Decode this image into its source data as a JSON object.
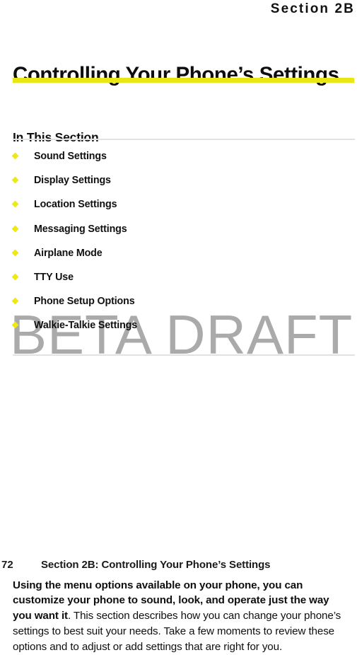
{
  "document": {
    "running_head": "Section 2B",
    "chapter_title": "Controlling Your Phone’s Settings",
    "accent_color": "#e8e613",
    "bullet_color": "#ece81a",
    "rule_color": "#e2e2e2"
  },
  "in_this_section": {
    "heading": "In This Section",
    "items": [
      {
        "label": "Sound Settings"
      },
      {
        "label": "Display Settings"
      },
      {
        "label": "Location Settings"
      },
      {
        "label": "Messaging Settings"
      },
      {
        "label": "Airplane Mode"
      },
      {
        "label": "TTY Use"
      },
      {
        "label": "Phone Setup Options"
      },
      {
        "label": "Walkie-Talkie Settings"
      }
    ]
  },
  "watermark": {
    "text": "BETA DRAFT",
    "color": "#aaaaaa"
  },
  "body": {
    "lead": "Using the menu options available on your phone, you can customize your phone to sound, look, and operate just the way you want it",
    "rest": ". This section describes how you can change your phone’s settings to best suit your needs. Take a few moments to review these options and to adjust or add settings that are right for you."
  },
  "footer": {
    "page_number": "72",
    "title": "Section 2B: Controlling Your Phone’s Settings"
  }
}
